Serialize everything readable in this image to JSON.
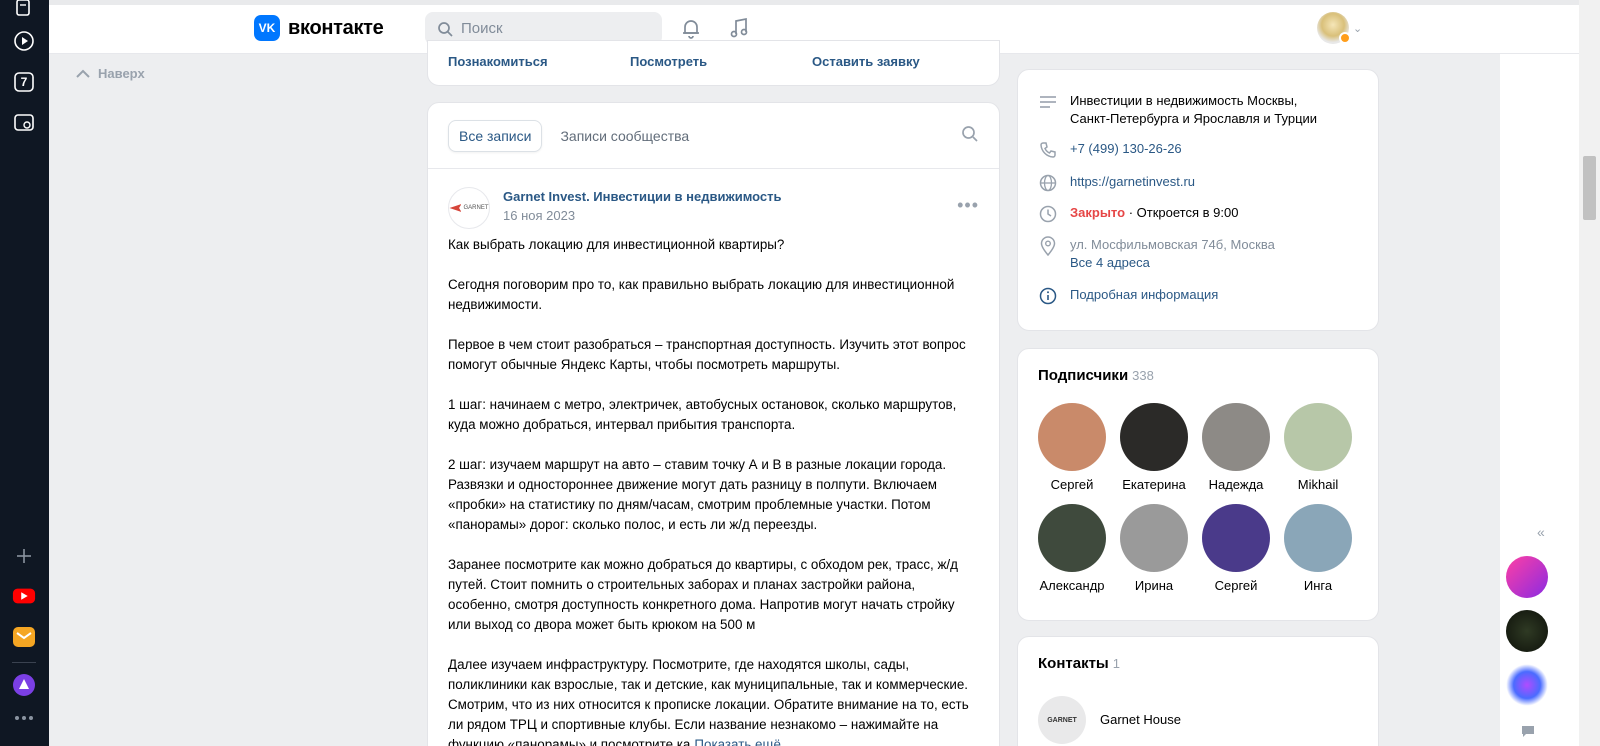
{
  "header": {
    "logo_text": "вконтакте",
    "search_placeholder": "Поиск"
  },
  "nav": {
    "back_to_top": "Наверх"
  },
  "top_card": {
    "links": [
      "Познакомиться",
      "Посмотреть",
      "Оставить заявку"
    ]
  },
  "feed": {
    "tabs": [
      "Все записи",
      "Записи сообщества"
    ],
    "post": {
      "avatar_text": "GARNET",
      "author": "Garnet Invest. Инвестиции в недвижимость",
      "date": "16 ноя 2023",
      "paragraphs": [
        "Как выбрать локацию для инвестиционной квартиры?",
        "Сегодня поговорим про то, как правильно выбрать локацию для инвестиционной недвижимости.",
        "Первое в чем стоит разобраться – транспортная доступность. Изучить этот вопрос помогут обычные Яндекс Карты, чтобы посмотреть маршруты.",
        "1 шаг: начинаем с метро, электричек, автобусных остановок, сколько маршрутов, куда можно добраться, интервал прибытия транспорта.",
        "2 шаг: изучаем маршрут на авто – ставим точку А и В в разные локации города. Развязки и одностороннее движение могут дать разницу в полпути. Включаем «пробки» на статистику по дням/часам, смотрим проблемные участки. Потом «панорамы» дорог: сколько полос, и есть ли ж/д переезды.",
        "Заранее посмотрите как можно добраться до квартиры, с обходом рек, трасс, ж/д путей. Стоит помнить о строительных заборах и планах застройки района, особенно, смотря доступность конкретного дома. Напротив могут начать стройку или выход со двора может быть крюком на 500 м",
        "Далее изучаем инфраструктуру. Посмотрите, где находятся школы, сады, поликлиники как взрослые, так и детские, как муниципальные, так и коммерческие. Смотрим, что из них относится к прописке локации. Обратите внимание на то, есть ли рядом ТРЦ и спортивные клубы. Если название незнакомо – нажимайте на функцию «панорамы» и посмотрите ка"
      ],
      "show_more": "Показать ещё"
    }
  },
  "info": {
    "description": "Инвестиции в недвижимость Москвы, Санкт-Петербурга и Ярославля и Турции",
    "phone": "+7 (499) 130-26-26",
    "website": "https://garnetinvest.ru",
    "status_closed": "Закрыто",
    "status_opens": "· Откроется в 9:00",
    "address": "ул. Мосфильмовская 74б, Москва",
    "all_addresses": "Все 4 адреса",
    "more_info": "Подробная информация"
  },
  "subscribers": {
    "title": "Подписчики",
    "count": "338",
    "people": [
      {
        "name": "Сергей",
        "color": "#c98a6a"
      },
      {
        "name": "Екатерина",
        "color": "#2b2a28"
      },
      {
        "name": "Надежда",
        "color": "#8d8a86"
      },
      {
        "name": "Mikhail",
        "color": "#b7c7a8"
      },
      {
        "name": "Александр",
        "color": "#3f4a3d"
      },
      {
        "name": "Ирина",
        "color": "#9a9a9a"
      },
      {
        "name": "Сергей",
        "color": "#4a3a8a"
      },
      {
        "name": "Инга",
        "color": "#8aa6b8"
      }
    ]
  },
  "contacts": {
    "title": "Контакты",
    "count": "1",
    "contact_name": "Garnet House",
    "contact_avatar_text": "GARNET"
  },
  "browser": {
    "sidebar_badge": "7"
  }
}
